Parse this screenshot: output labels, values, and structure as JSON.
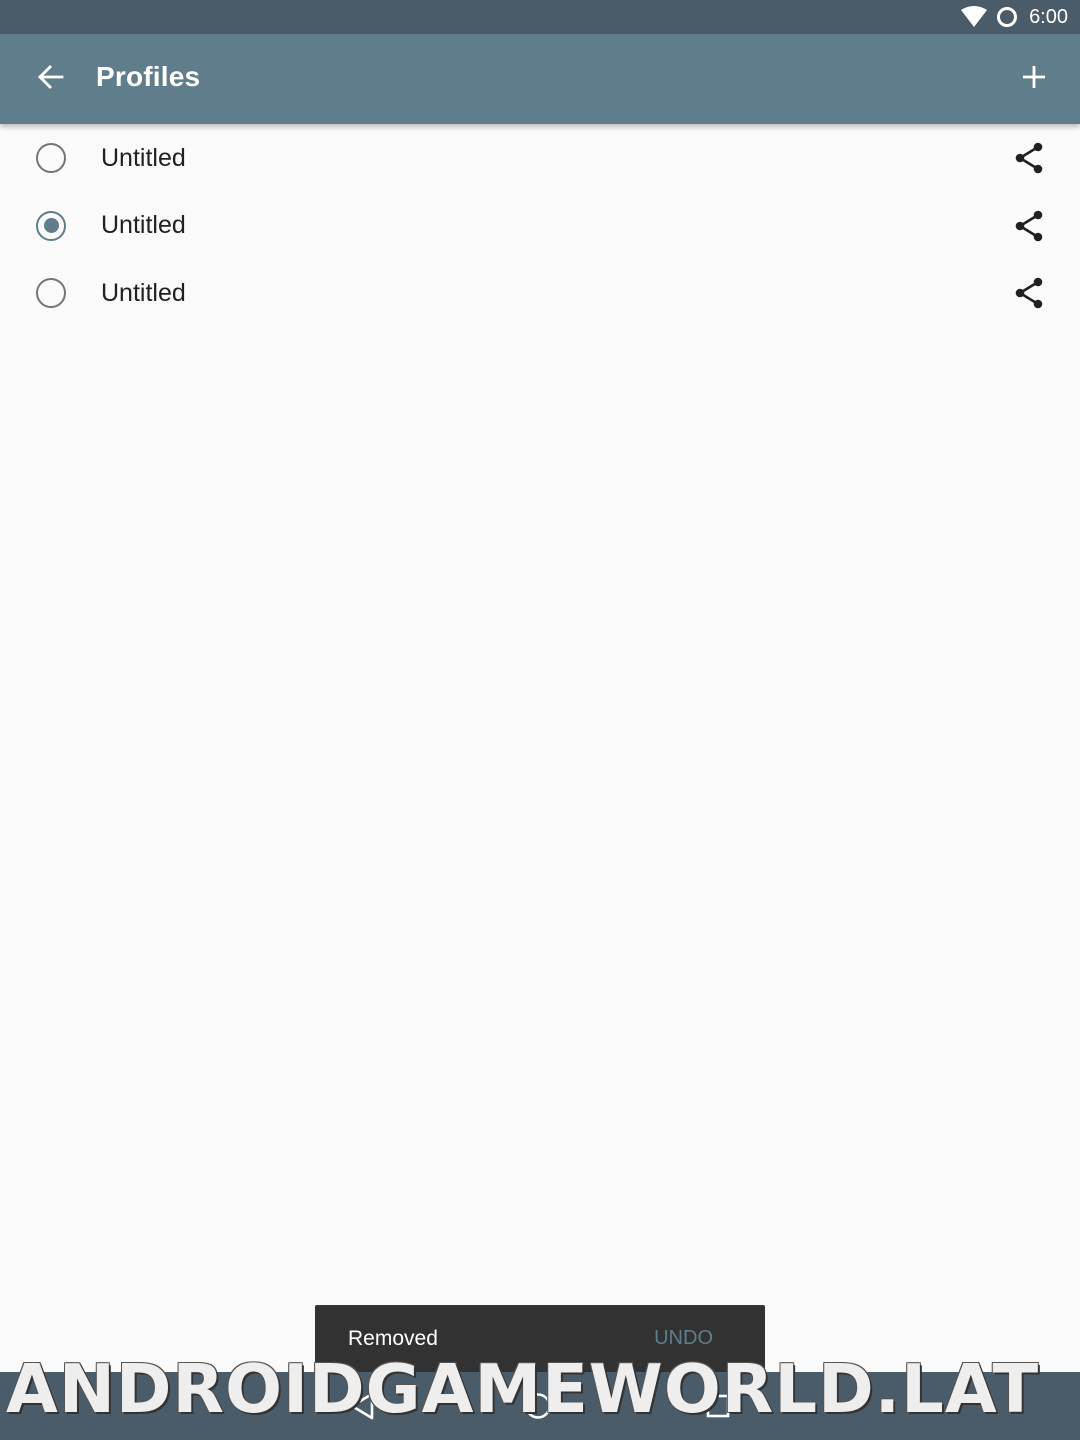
{
  "status_bar": {
    "time": "6:00",
    "icons": [
      "wifi-icon",
      "sync-icon"
    ]
  },
  "app_bar": {
    "title": "Profiles",
    "back_icon": "arrow-back-icon",
    "add_icon": "plus-icon"
  },
  "profiles": [
    {
      "name": "Untitled",
      "selected": false
    },
    {
      "name": "Untitled",
      "selected": true
    },
    {
      "name": "Untitled",
      "selected": false
    }
  ],
  "snackbar": {
    "message": "Removed",
    "action": "UNDO"
  },
  "nav_bar": {
    "icons": [
      "back-triangle-icon",
      "home-circle-icon",
      "recents-square-icon"
    ]
  },
  "watermark": "ANDROIDGAMEWORLD.LAT",
  "colors": {
    "status_bar": "#4a5c69",
    "app_bar": "#607d8b",
    "accent": "#607d8b",
    "background": "#fafafa",
    "snackbar": "#323232"
  }
}
